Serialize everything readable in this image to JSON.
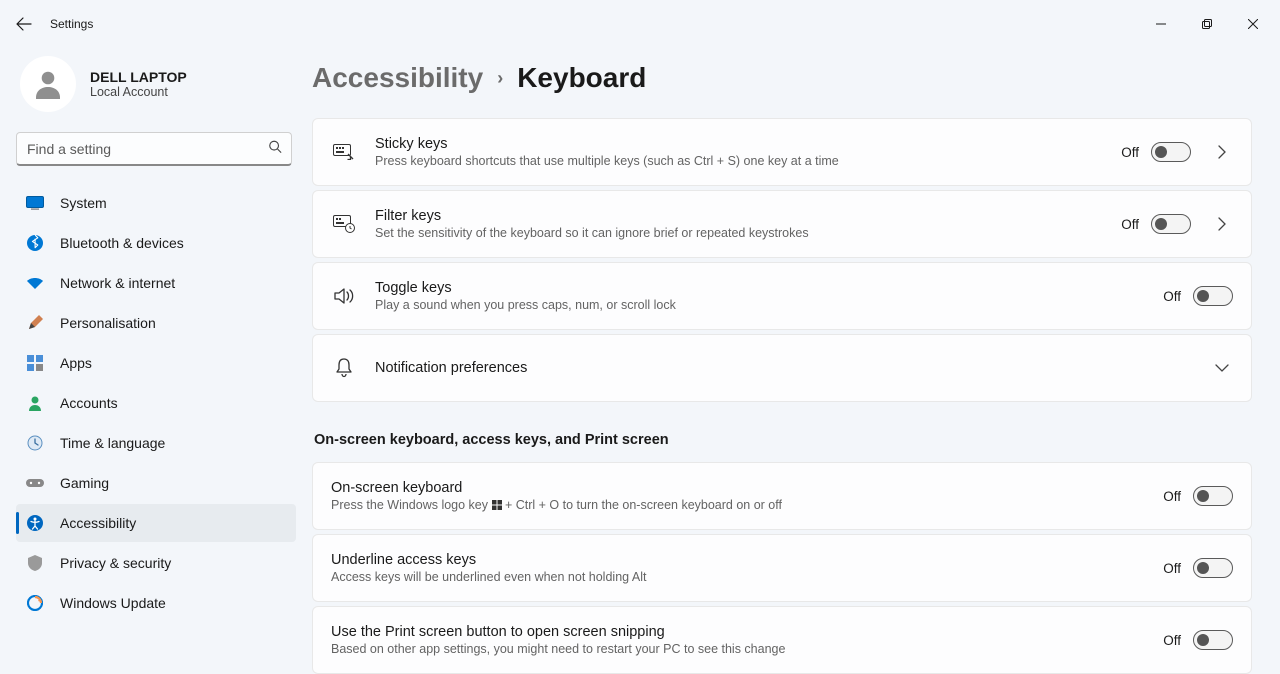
{
  "app_title": "Settings",
  "profile": {
    "name": "DELL LAPTOP",
    "sub": "Local Account"
  },
  "search": {
    "placeholder": "Find a setting"
  },
  "nav": {
    "items": [
      {
        "label": "System"
      },
      {
        "label": "Bluetooth & devices"
      },
      {
        "label": "Network & internet"
      },
      {
        "label": "Personalisation"
      },
      {
        "label": "Apps"
      },
      {
        "label": "Accounts"
      },
      {
        "label": "Time & language"
      },
      {
        "label": "Gaming"
      },
      {
        "label": "Accessibility"
      },
      {
        "label": "Privacy & security"
      },
      {
        "label": "Windows Update"
      }
    ]
  },
  "breadcrumb": {
    "parent": "Accessibility",
    "current": "Keyboard"
  },
  "cards1": [
    {
      "title": "Sticky keys",
      "sub": "Press keyboard shortcuts that use multiple keys (such as Ctrl + S) one key at a time",
      "state": "Off",
      "has_chevron": true
    },
    {
      "title": "Filter keys",
      "sub": "Set the sensitivity of the keyboard so it can ignore brief or repeated keystrokes",
      "state": "Off",
      "has_chevron": true
    },
    {
      "title": "Toggle keys",
      "sub": "Play a sound when you press caps, num, or scroll lock",
      "state": "Off",
      "has_chevron": false
    },
    {
      "title": "Notification preferences",
      "sub": "",
      "state": "",
      "has_chevron": false
    }
  ],
  "section2_heading": "On-screen keyboard, access keys, and Print screen",
  "cards2": [
    {
      "title": "On-screen keyboard",
      "sub_pre": "Press the Windows logo key ",
      "sub_post": " + Ctrl + O to turn the on-screen keyboard on or off",
      "state": "Off"
    },
    {
      "title": "Underline access keys",
      "sub": "Access keys will be underlined even when not holding Alt",
      "state": "Off"
    },
    {
      "title": "Use the Print screen button to open screen snipping",
      "sub": "Based on other app settings, you might need to restart your PC to see this change",
      "state": "Off"
    }
  ]
}
